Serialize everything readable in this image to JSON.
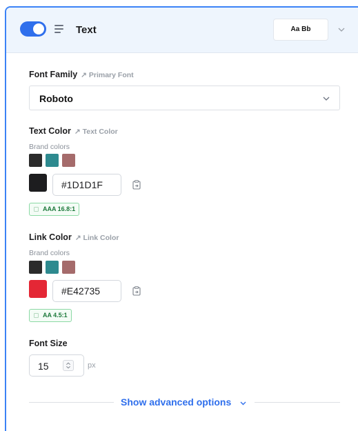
{
  "header": {
    "title": "Text",
    "preview_text": "Aa Bb",
    "toggle_on": true
  },
  "font_family": {
    "label": "Font Family",
    "link_text": "Primary Font",
    "value": "Roboto"
  },
  "text_color": {
    "label": "Text Color",
    "link_text": "Text Color",
    "brand_label": "Brand colors",
    "brand_swatches": [
      "#2b2b2b",
      "#2e8a8f",
      "#a56b6b"
    ],
    "current_color": "#1D1D1F",
    "hex_value": "#1D1D1F",
    "contrast_badge": "AAA 16.8:1"
  },
  "link_color": {
    "label": "Link Color",
    "link_text": "Link Color",
    "brand_label": "Brand colors",
    "brand_swatches": [
      "#2b2b2b",
      "#2e8a8f",
      "#a56b6b"
    ],
    "current_color": "#E42735",
    "hex_value": "#E42735",
    "contrast_badge": "AA 4.5:1"
  },
  "font_size": {
    "label": "Font Size",
    "value": "15",
    "unit": "px"
  },
  "advanced": {
    "label": "Show advanced options"
  },
  "colors": {
    "accent": "#2f6fec",
    "panel_border": "#3b82f6",
    "header_bg": "#eef5fd"
  }
}
